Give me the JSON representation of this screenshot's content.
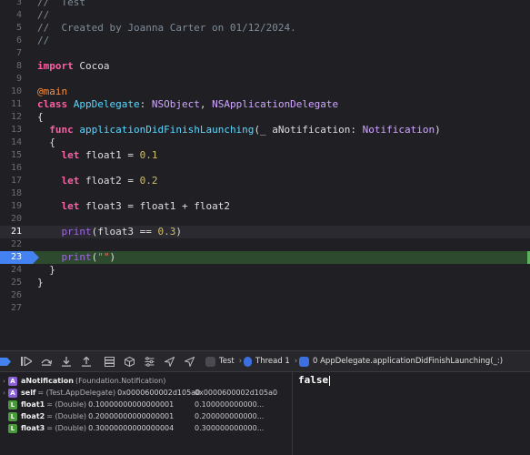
{
  "editor": {
    "lines": [
      {
        "n": "3",
        "tokens": [
          {
            "c": "cm",
            "t": "//  Test"
          }
        ]
      },
      {
        "n": "4",
        "tokens": [
          {
            "c": "cm",
            "t": "//"
          }
        ]
      },
      {
        "n": "5",
        "tokens": [
          {
            "c": "cm",
            "t": "//  Created by Joanna Carter on 01/12/2024."
          }
        ]
      },
      {
        "n": "6",
        "tokens": [
          {
            "c": "cm",
            "t": "//"
          }
        ]
      },
      {
        "n": "7",
        "tokens": []
      },
      {
        "n": "8",
        "tokens": [
          {
            "c": "kw",
            "t": "import"
          },
          {
            "c": "",
            "t": " Cocoa"
          }
        ]
      },
      {
        "n": "9",
        "tokens": []
      },
      {
        "n": "10",
        "tokens": [
          {
            "c": "attr",
            "t": "@main"
          }
        ]
      },
      {
        "n": "11",
        "tokens": [
          {
            "c": "kw",
            "t": "class"
          },
          {
            "c": "",
            "t": " "
          },
          {
            "c": "fnc",
            "t": "AppDelegate"
          },
          {
            "c": "",
            "t": ": "
          },
          {
            "c": "ty",
            "t": "NSObject"
          },
          {
            "c": "",
            "t": ", "
          },
          {
            "c": "ty",
            "t": "NSApplicationDelegate"
          }
        ]
      },
      {
        "n": "12",
        "tokens": [
          {
            "c": "",
            "t": "{"
          }
        ]
      },
      {
        "n": "13",
        "tokens": [
          {
            "c": "",
            "t": "  "
          },
          {
            "c": "kw",
            "t": "func"
          },
          {
            "c": "",
            "t": " "
          },
          {
            "c": "fnc",
            "t": "applicationDidFinishLaunching"
          },
          {
            "c": "",
            "t": "(_ aNotification: "
          },
          {
            "c": "ty",
            "t": "Notification"
          },
          {
            "c": "",
            "t": ")"
          }
        ]
      },
      {
        "n": "14",
        "tokens": [
          {
            "c": "",
            "t": "  {"
          }
        ]
      },
      {
        "n": "15",
        "tokens": [
          {
            "c": "",
            "t": "    "
          },
          {
            "c": "kw",
            "t": "let"
          },
          {
            "c": "",
            "t": " float1 = "
          },
          {
            "c": "num",
            "t": "0.1"
          }
        ]
      },
      {
        "n": "16",
        "tokens": []
      },
      {
        "n": "17",
        "tokens": [
          {
            "c": "",
            "t": "    "
          },
          {
            "c": "kw",
            "t": "let"
          },
          {
            "c": "",
            "t": " float2 = "
          },
          {
            "c": "num",
            "t": "0.2"
          }
        ]
      },
      {
        "n": "18",
        "tokens": []
      },
      {
        "n": "19",
        "tokens": [
          {
            "c": "",
            "t": "    "
          },
          {
            "c": "kw",
            "t": "let"
          },
          {
            "c": "",
            "t": " float3 = float1 + float2"
          }
        ]
      },
      {
        "n": "20",
        "tokens": []
      },
      {
        "n": "21",
        "tokens": [
          {
            "c": "",
            "t": "    "
          },
          {
            "c": "pr",
            "t": "print"
          },
          {
            "c": "",
            "t": "(float3 == "
          },
          {
            "c": "num",
            "t": "0.3"
          },
          {
            "c": "",
            "t": ")"
          }
        ],
        "state": "cur"
      },
      {
        "n": "22",
        "tokens": []
      },
      {
        "n": "23",
        "tokens": [
          {
            "c": "",
            "t": "    "
          },
          {
            "c": "pr",
            "t": "print"
          },
          {
            "c": "",
            "t": "("
          },
          {
            "c": "str",
            "t": "\"\""
          },
          {
            "c": "",
            "t": ")"
          }
        ],
        "state": "bp"
      },
      {
        "n": "24",
        "tokens": [
          {
            "c": "",
            "t": "  }"
          }
        ]
      },
      {
        "n": "25",
        "tokens": [
          {
            "c": "",
            "t": "}"
          }
        ]
      },
      {
        "n": "26",
        "tokens": []
      },
      {
        "n": "27",
        "tokens": []
      }
    ]
  },
  "debug_bar": {
    "target": "Test",
    "thread": "Thread 1",
    "frame": "0 AppDelegate.applicationDidFinishLaunching(_:)",
    "chip_colors": {
      "target": "#4a4a50",
      "thread": "#3c6fe0",
      "frame": "#3c6fe0"
    }
  },
  "variables": [
    {
      "badge": "A",
      "badge_color": "#8b5fd6",
      "disclosure": "›",
      "name": "aNotification",
      "type": "(Foundation.Notification)",
      "value": "",
      "summary": ""
    },
    {
      "badge": "A",
      "badge_color": "#8b5fd6",
      "disclosure": "›",
      "name": "self",
      "type": "= (Test.AppDelegate)",
      "value": "0x0000600002d105a0",
      "summary": "0x0000600002d105a0"
    },
    {
      "badge": "L",
      "badge_color": "#4a9a3c",
      "disclosure": "",
      "name": "float1",
      "type": "= (Double)",
      "value": "0.10000000000000001",
      "summary": "0.100000000000..."
    },
    {
      "badge": "L",
      "badge_color": "#4a9a3c",
      "disclosure": "",
      "name": "float2",
      "type": "= (Double)",
      "value": "0.20000000000000001",
      "summary": "0.200000000000..."
    },
    {
      "badge": "L",
      "badge_color": "#4a9a3c",
      "disclosure": "",
      "name": "float3",
      "type": "= (Double)",
      "value": "0.30000000000000004",
      "summary": "0.300000000000..."
    }
  ],
  "console": {
    "output": "false"
  }
}
